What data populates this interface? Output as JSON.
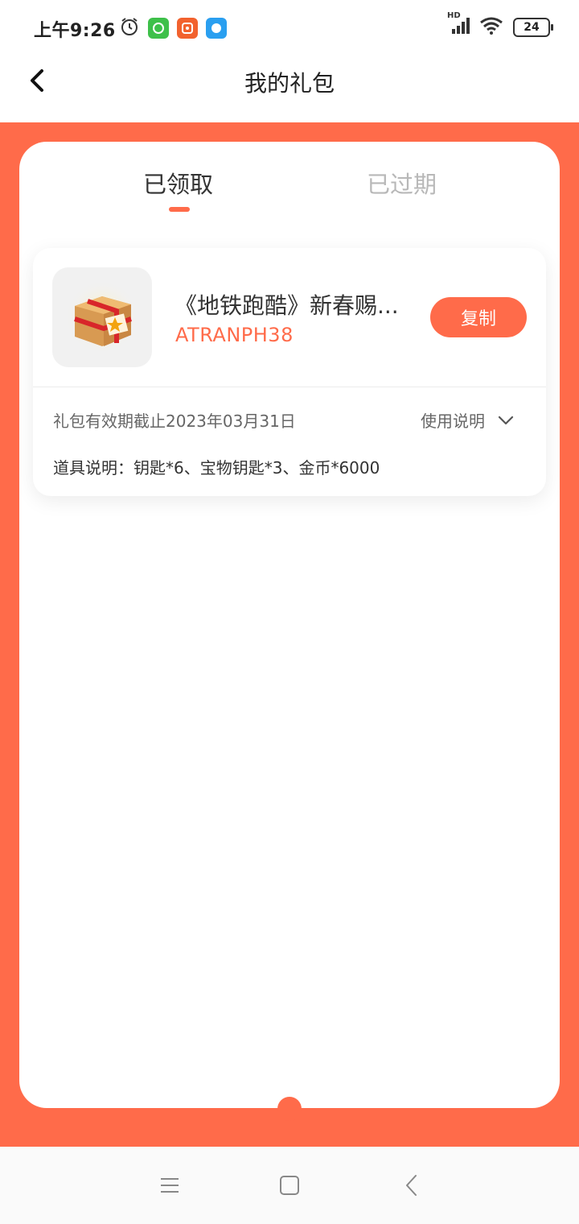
{
  "status_bar": {
    "time": "上午9:26",
    "battery": "24",
    "network_label": "HD",
    "icons": [
      "alarm-icon",
      "app-green-icon",
      "app-orange-icon",
      "app-blue-icon",
      "signal-icon",
      "wifi-icon",
      "battery-icon"
    ]
  },
  "header": {
    "title": "我的礼包",
    "back_icon": "chevron-left-icon"
  },
  "tabs": [
    {
      "label": "已领取",
      "active": true
    },
    {
      "label": "已过期",
      "active": false
    }
  ],
  "gift": {
    "name": "《地铁跑酷》新春赐...",
    "code": "ATRANPH38",
    "copy_label": "复制",
    "validity": "礼包有效期截止2023年03月31日",
    "usage_label": "使用说明",
    "items_desc": "道具说明：钥匙*6、宝物钥匙*3、金币*6000",
    "icon": "gift-box-icon"
  },
  "colors": {
    "accent": "#ff6b4a",
    "tab_inactive": "#b8b8b8"
  },
  "nav_bar": {
    "icons": [
      "menu-icon",
      "home-icon",
      "back-icon"
    ]
  }
}
